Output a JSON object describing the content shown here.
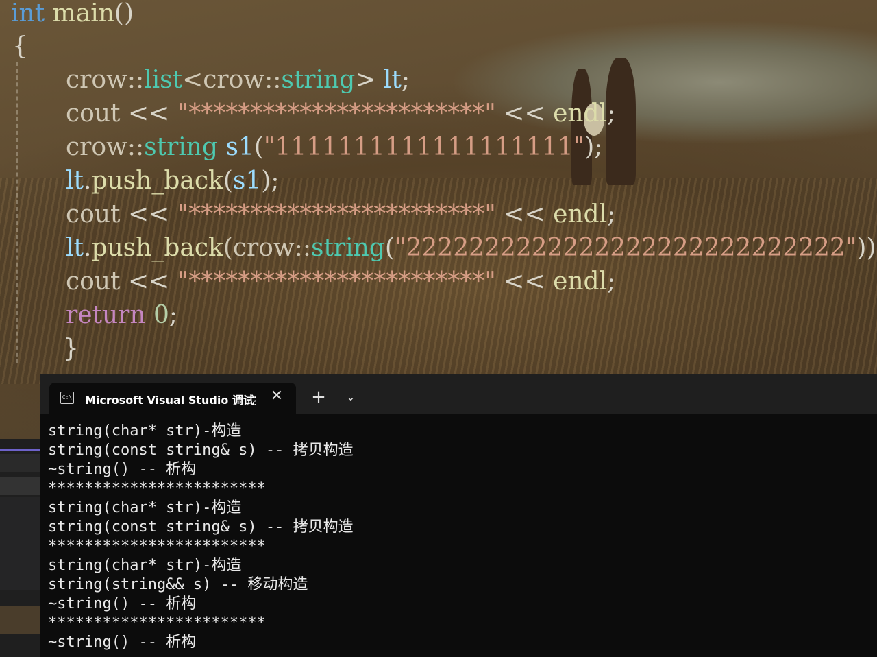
{
  "editor": {
    "lines": [
      {
        "parts": [
          {
            "t": "int",
            "c": "kw"
          },
          {
            "t": " main",
            "c": "fn"
          },
          {
            "t": "()",
            "c": "plain"
          }
        ]
      },
      {
        "parts": [
          {
            "t": "{",
            "c": "plain"
          }
        ]
      },
      {
        "parts": [
          {
            "t": "crow::",
            "c": "ns"
          },
          {
            "t": "list",
            "c": "type"
          },
          {
            "t": "<crow::",
            "c": "ns"
          },
          {
            "t": "string",
            "c": "type"
          },
          {
            "t": "> ",
            "c": "plain"
          },
          {
            "t": "lt",
            "c": "var"
          },
          {
            "t": ";",
            "c": "plain"
          }
        ]
      },
      {
        "parts": [
          {
            "t": "cout ",
            "c": "ns"
          },
          {
            "t": "<< ",
            "c": "plain"
          },
          {
            "t": "\"************************\"",
            "c": "str"
          },
          {
            "t": " << ",
            "c": "plain"
          },
          {
            "t": "endl",
            "c": "fn"
          },
          {
            "t": ";",
            "c": "plain"
          }
        ]
      },
      {
        "parts": [
          {
            "t": "crow::",
            "c": "ns"
          },
          {
            "t": "string",
            "c": "type"
          },
          {
            "t": " s1",
            "c": "var"
          },
          {
            "t": "(",
            "c": "plain"
          },
          {
            "t": "\"1111111111111111111\"",
            "c": "str"
          },
          {
            "t": ");",
            "c": "plain"
          }
        ]
      },
      {
        "parts": [
          {
            "t": "lt",
            "c": "var"
          },
          {
            "t": ".",
            "c": "plain"
          },
          {
            "t": "push_back",
            "c": "fn"
          },
          {
            "t": "(",
            "c": "plain"
          },
          {
            "t": "s1",
            "c": "var"
          },
          {
            "t": ");",
            "c": "plain"
          }
        ]
      },
      {
        "parts": [
          {
            "t": "cout ",
            "c": "ns"
          },
          {
            "t": "<< ",
            "c": "plain"
          },
          {
            "t": "\"************************\"",
            "c": "str"
          },
          {
            "t": " << ",
            "c": "plain"
          },
          {
            "t": "endl",
            "c": "fn"
          },
          {
            "t": ";",
            "c": "plain"
          }
        ]
      },
      {
        "parts": [
          {
            "t": "lt",
            "c": "var"
          },
          {
            "t": ".",
            "c": "plain"
          },
          {
            "t": "push_back",
            "c": "fn"
          },
          {
            "t": "(crow::",
            "c": "ns"
          },
          {
            "t": "string",
            "c": "type"
          },
          {
            "t": "(",
            "c": "plain"
          },
          {
            "t": "\"2222222222222222222222222222\"",
            "c": "str"
          },
          {
            "t": "))",
            "c": "plain"
          }
        ]
      },
      {
        "parts": [
          {
            "t": "cout ",
            "c": "ns"
          },
          {
            "t": "<< ",
            "c": "plain"
          },
          {
            "t": "\"************************\"",
            "c": "str"
          },
          {
            "t": " << ",
            "c": "plain"
          },
          {
            "t": "endl",
            "c": "fn"
          },
          {
            "t": ";",
            "c": "plain"
          }
        ]
      },
      {
        "parts": [
          {
            "t": "return",
            "c": "ret"
          },
          {
            "t": " 0",
            "c": "num"
          },
          {
            "t": ";",
            "c": "plain"
          }
        ]
      },
      {
        "parts": [
          {
            "t": "}",
            "c": "plain"
          }
        ]
      }
    ]
  },
  "terminal": {
    "tab_title": "Microsoft Visual Studio 调试控制台",
    "tab_icon_text": "C:\\",
    "close_glyph": "✕",
    "new_tab_glyph": "+",
    "dropdown_glyph": "⌄",
    "output": [
      "string(char* str)-构造",
      "string(const string& s) -- 拷贝构造",
      "~string() -- 析构",
      "************************",
      "string(char* str)-构造",
      "string(const string& s) -- 拷贝构造",
      "************************",
      "string(char* str)-构造",
      "string(string&& s) -- 移动构造",
      "~string() -- 析构",
      "************************",
      "~string() -- 析构"
    ]
  }
}
